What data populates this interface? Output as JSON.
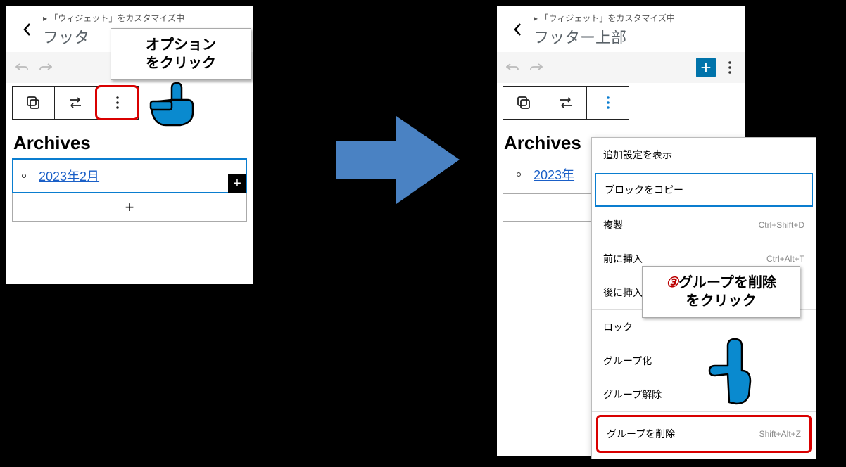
{
  "left": {
    "breadcrumb": "「ウィジェット」をカスタマイズ中",
    "title_truncated": "フッタ",
    "archives": "Archives",
    "link": "2023年2月"
  },
  "right": {
    "breadcrumb": "「ウィジェット」をカスタマイズ中",
    "title": "フッター上部",
    "archives": "Archives",
    "link": "2023年"
  },
  "menu": {
    "show_more": "追加設定を表示",
    "copy": "ブロックをコピー",
    "duplicate": "複製",
    "duplicate_kbd": "Ctrl+Shift+D",
    "before": "前に挿入",
    "before_kbd": "Ctrl+Alt+T",
    "after": "後に挿入",
    "lock": "ロック",
    "group": "グループ化",
    "ungroup": "グループ解除",
    "delete": "グループを削除",
    "delete_kbd": "Shift+Alt+Z"
  },
  "callouts": {
    "c1_line1": "オプション",
    "c1_line2": "をクリック",
    "c2_num": "③",
    "c2_line1": "グループを削除",
    "c2_line2": "をクリック"
  }
}
